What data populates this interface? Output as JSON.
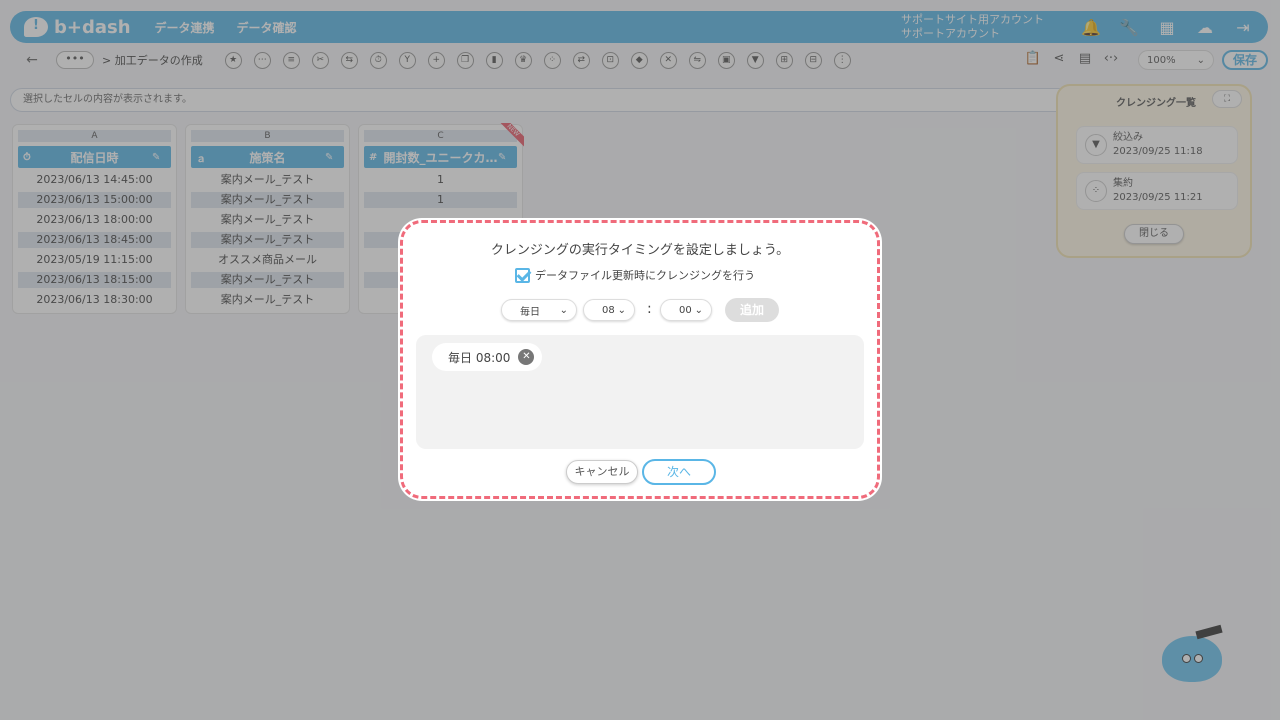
{
  "header": {
    "logo": "b+dash",
    "nav": [
      "データ連携",
      "データ確認"
    ],
    "account_line1": "サポートサイト用アカウント",
    "account_line2": "サポートアカウント"
  },
  "toolbar": {
    "more": "•••",
    "breadcrumb": "> 加工データの作成",
    "zoom": "100%",
    "save": "保存"
  },
  "cellbar": {
    "text": "選択したセルの内容が表示されます。"
  },
  "columns": [
    {
      "letter": "A",
      "header": "配信日時",
      "rows": [
        "2023/06/13 14:45:00",
        "2023/06/13 15:00:00",
        "2023/06/13 18:00:00",
        "2023/06/13 18:45:00",
        "2023/05/19 11:15:00",
        "2023/06/13 18:15:00",
        "2023/06/13 18:30:00"
      ]
    },
    {
      "letter": "B",
      "header": "施策名",
      "rows": [
        "案内メール_テスト",
        "案内メール_テスト",
        "案内メール_テスト",
        "案内メール_テスト",
        "オススメ商品メール",
        "案内メール_テスト",
        "案内メール_テスト"
      ]
    },
    {
      "letter": "C",
      "header": "開封数_ユニークカ…",
      "rows": [
        "1",
        "1",
        "",
        "",
        "",
        "",
        ""
      ],
      "badge": "NEW"
    }
  ],
  "panel": {
    "title": "クレンジング一覧",
    "items": [
      {
        "label": "絞込み",
        "date": "2023/09/25 11:18"
      },
      {
        "label": "集約",
        "date": "2023/09/25 11:21"
      }
    ],
    "close": "閉じる"
  },
  "modal": {
    "title": "クレンジングの実行タイミングを設定しましょう。",
    "checkbox_label": "データファイル更新時にクレンジングを行う",
    "frequency": "毎日",
    "hour": "08",
    "colon": ":",
    "minute": "00",
    "add": "追加",
    "tag": "毎日 08:00",
    "cancel": "キャンセル",
    "next": "次へ"
  }
}
